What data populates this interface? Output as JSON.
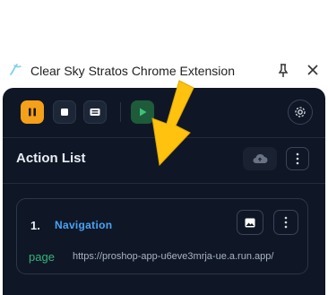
{
  "window": {
    "title": "Clear Sky Stratos Chrome Extension",
    "app_icon": "clear-sky-logo-icon",
    "pin_icon": "pin-icon",
    "close_icon": "close-icon"
  },
  "toolbar": {
    "buttons": [
      "pause-icon",
      "stop-icon",
      "keyboard-icon",
      "play-icon",
      "gear-icon"
    ],
    "accent": "#f5a019",
    "play_color": "#1e5b3a"
  },
  "action_list": {
    "title": "Action List",
    "cloud_icon": "cloud-upload-icon",
    "more_icon": "vertical-dots-icon",
    "items": [
      {
        "number": "1.",
        "name": "Navigation",
        "type": "page",
        "url": "https://proshop-app-u6eve3mrja-ue.a.run.app/"
      }
    ]
  },
  "overlay": {
    "annotation_arrow_icon": "arrow-down-left-icon",
    "color": "#ffc20e"
  },
  "colors": {
    "panel_bg": "#0f1726",
    "link_blue": "#4aa3f5",
    "type_green": "#35b37a"
  }
}
